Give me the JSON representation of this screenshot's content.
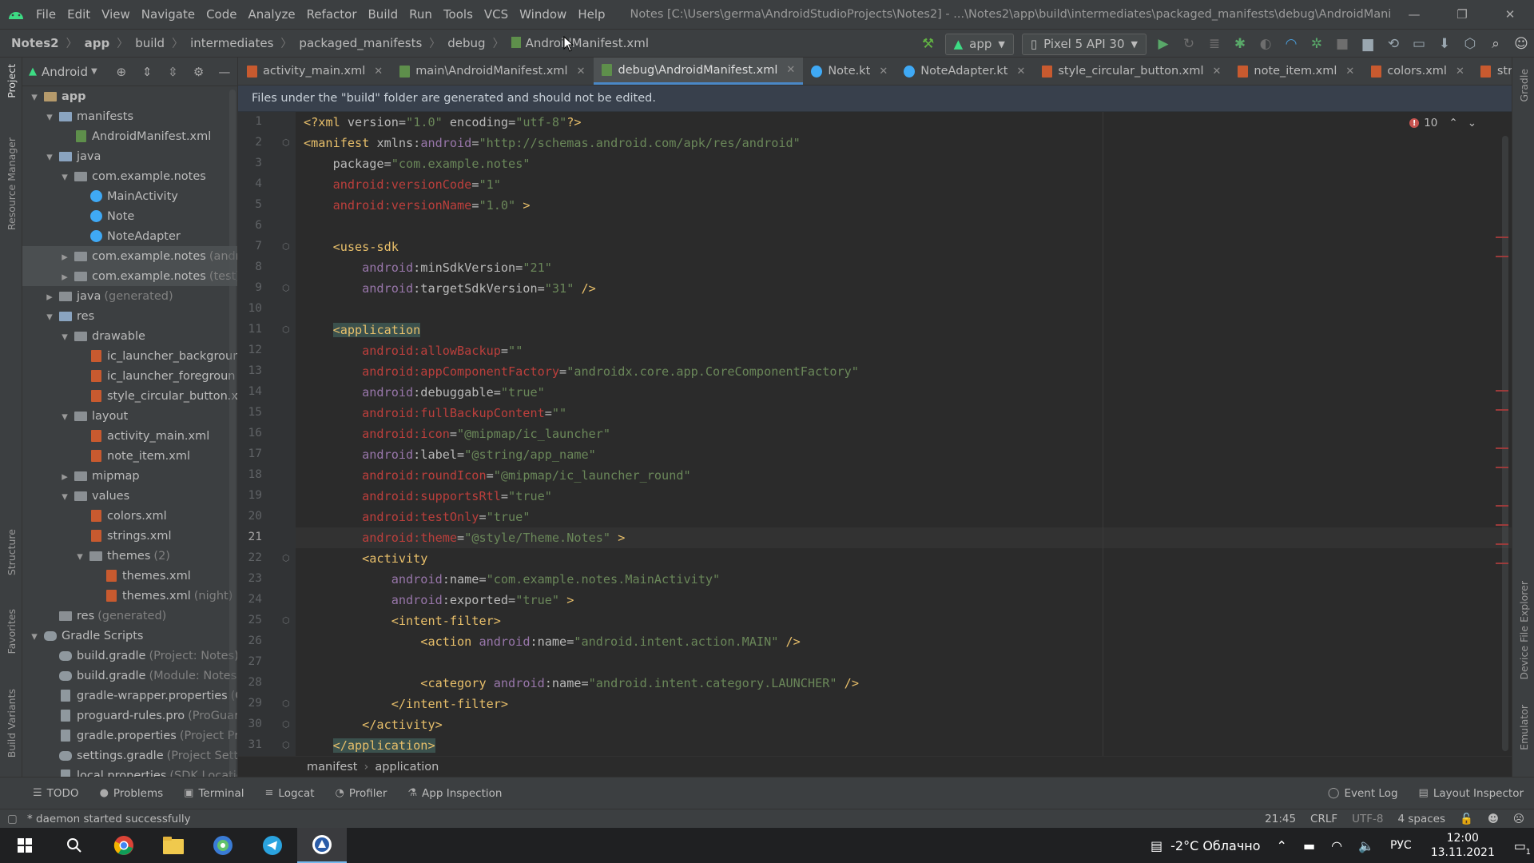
{
  "window": {
    "title": "Notes [C:\\Users\\germa\\AndroidStudioProjects\\Notes2] - ...\\Notes2\\app\\build\\intermediates\\packaged_manifests\\debug\\AndroidManifest.xml",
    "minimize": "—",
    "restore": "❐",
    "close": "✕"
  },
  "menu": [
    "File",
    "Edit",
    "View",
    "Navigate",
    "Code",
    "Analyze",
    "Refactor",
    "Build",
    "Run",
    "Tools",
    "VCS",
    "Window",
    "Help"
  ],
  "breadcrumb": [
    "Notes2",
    "app",
    "build",
    "intermediates",
    "packaged_manifests",
    "debug",
    "AndroidManifest.xml"
  ],
  "toolbar": {
    "run_config": "app",
    "device": "Pixel 5 API 30"
  },
  "left_strip": [
    "Project",
    "Resource Manager",
    "Structure",
    "Favorites",
    "Build Variants"
  ],
  "right_strip": [
    "Gradle",
    "Device File Explorer",
    "Emulator"
  ],
  "project_panel": {
    "view_name": "Android",
    "tree": [
      {
        "label": "app",
        "ext": "",
        "depth": 0,
        "arrow": "v",
        "icon": "folder-tan",
        "bold": true
      },
      {
        "label": "manifests",
        "ext": "",
        "depth": 1,
        "arrow": "v",
        "icon": "folder"
      },
      {
        "label": "AndroidManifest.xml",
        "ext": "",
        "depth": 2,
        "arrow": "",
        "icon": "xml-green"
      },
      {
        "label": "java",
        "ext": "",
        "depth": 1,
        "arrow": "v",
        "icon": "folder"
      },
      {
        "label": "com.example.notes",
        "ext": "",
        "depth": 2,
        "arrow": "v",
        "icon": "folder-grey"
      },
      {
        "label": "MainActivity",
        "ext": "",
        "depth": 3,
        "arrow": "",
        "icon": "kt"
      },
      {
        "label": "Note",
        "ext": "",
        "depth": 3,
        "arrow": "",
        "icon": "kt"
      },
      {
        "label": "NoteAdapter",
        "ext": "",
        "depth": 3,
        "arrow": "",
        "icon": "kt"
      },
      {
        "label": "com.example.notes",
        "ext": "(andro",
        "depth": 2,
        "arrow": ">",
        "icon": "folder-grey",
        "sel": true
      },
      {
        "label": "com.example.notes",
        "ext": "(test)",
        "depth": 2,
        "arrow": ">",
        "icon": "folder-grey",
        "sel": true
      },
      {
        "label": "java",
        "ext": "(generated)",
        "depth": 1,
        "arrow": ">",
        "icon": "folder-grey"
      },
      {
        "label": "res",
        "ext": "",
        "depth": 1,
        "arrow": "v",
        "icon": "folder"
      },
      {
        "label": "drawable",
        "ext": "",
        "depth": 2,
        "arrow": "v",
        "icon": "folder-grey"
      },
      {
        "label": "ic_launcher_backgroun",
        "ext": "",
        "depth": 3,
        "arrow": "",
        "icon": "xml"
      },
      {
        "label": "ic_launcher_foregroun",
        "ext": "",
        "depth": 3,
        "arrow": "",
        "icon": "xml"
      },
      {
        "label": "style_circular_button.xm",
        "ext": "",
        "depth": 3,
        "arrow": "",
        "icon": "xml"
      },
      {
        "label": "layout",
        "ext": "",
        "depth": 2,
        "arrow": "v",
        "icon": "folder-grey"
      },
      {
        "label": "activity_main.xml",
        "ext": "",
        "depth": 3,
        "arrow": "",
        "icon": "xml"
      },
      {
        "label": "note_item.xml",
        "ext": "",
        "depth": 3,
        "arrow": "",
        "icon": "xml"
      },
      {
        "label": "mipmap",
        "ext": "",
        "depth": 2,
        "arrow": ">",
        "icon": "folder-grey"
      },
      {
        "label": "values",
        "ext": "",
        "depth": 2,
        "arrow": "v",
        "icon": "folder-grey"
      },
      {
        "label": "colors.xml",
        "ext": "",
        "depth": 3,
        "arrow": "",
        "icon": "xml"
      },
      {
        "label": "strings.xml",
        "ext": "",
        "depth": 3,
        "arrow": "",
        "icon": "xml"
      },
      {
        "label": "themes",
        "ext": "(2)",
        "depth": 3,
        "arrow": "v",
        "icon": "folder-grey"
      },
      {
        "label": "themes.xml",
        "ext": "",
        "depth": 4,
        "arrow": "",
        "icon": "xml"
      },
      {
        "label": "themes.xml",
        "ext": "(night)",
        "depth": 4,
        "arrow": "",
        "icon": "xml"
      },
      {
        "label": "res",
        "ext": "(generated)",
        "depth": 1,
        "arrow": "",
        "icon": "folder-grey"
      },
      {
        "label": "Gradle Scripts",
        "ext": "",
        "depth": 0,
        "arrow": "v",
        "icon": "gradle"
      },
      {
        "label": "build.gradle",
        "ext": "(Project: Notes)",
        "depth": 1,
        "arrow": "",
        "icon": "gradle"
      },
      {
        "label": "build.gradle",
        "ext": "(Module: Notes.a",
        "depth": 1,
        "arrow": "",
        "icon": "gradle"
      },
      {
        "label": "gradle-wrapper.properties",
        "ext": "(G",
        "depth": 1,
        "arrow": "",
        "icon": "prop"
      },
      {
        "label": "proguard-rules.pro",
        "ext": "(ProGuard",
        "depth": 1,
        "arrow": "",
        "icon": "prop"
      },
      {
        "label": "gradle.properties",
        "ext": "(Project Pro",
        "depth": 1,
        "arrow": "",
        "icon": "prop"
      },
      {
        "label": "settings.gradle",
        "ext": "(Project Settin",
        "depth": 1,
        "arrow": "",
        "icon": "gradle"
      },
      {
        "label": "local.properties",
        "ext": "(SDK Location",
        "depth": 1,
        "arrow": "",
        "icon": "prop"
      }
    ]
  },
  "tabs": [
    {
      "label": "activity_main.xml",
      "icon": "xml",
      "active": false
    },
    {
      "label": "main\\AndroidManifest.xml",
      "icon": "xml-green",
      "active": false
    },
    {
      "label": "debug\\AndroidManifest.xml",
      "icon": "xml-green",
      "active": true
    },
    {
      "label": "Note.kt",
      "icon": "kt",
      "active": false
    },
    {
      "label": "NoteAdapter.kt",
      "icon": "kt",
      "active": false
    },
    {
      "label": "style_circular_button.xml",
      "icon": "xml",
      "active": false
    },
    {
      "label": "note_item.xml",
      "icon": "xml",
      "active": false
    },
    {
      "label": "colors.xml",
      "icon": "xml",
      "active": false
    },
    {
      "label": "strings.xml",
      "icon": "xml",
      "active": false
    }
  ],
  "notice": "Files under the \"build\" folder are generated and should not be edited.",
  "editor": {
    "error_count": "10",
    "current_line": 21,
    "lines": [
      [
        [
          "t-pun",
          "<?"
        ],
        [
          "t-tag",
          "xml "
        ],
        [
          "t-attr",
          "version"
        ],
        [
          "t-attr",
          "="
        ],
        [
          "t-val",
          "\"1.0\""
        ],
        [
          "t-attr",
          " encoding"
        ],
        [
          "t-attr",
          "="
        ],
        [
          "t-val",
          "\"utf-8\""
        ],
        [
          "t-pun",
          "?>"
        ]
      ],
      [
        [
          "t-tag",
          "<manifest "
        ],
        [
          "t-attr",
          "xmlns:"
        ],
        [
          "t-ns",
          "android"
        ],
        [
          "t-attr",
          "="
        ],
        [
          "t-val",
          "\"http://schemas.android.com/apk/res/android\""
        ]
      ],
      [
        [
          "t-attr",
          "    package"
        ],
        [
          "t-attr",
          "="
        ],
        [
          "t-val",
          "\"com.example.notes\""
        ]
      ],
      [
        [
          "t-err",
          "    android:versionCode"
        ],
        [
          "t-attr",
          "="
        ],
        [
          "t-val",
          "\"1\""
        ]
      ],
      [
        [
          "t-err",
          "    android:versionName"
        ],
        [
          "t-attr",
          "="
        ],
        [
          "t-val",
          "\"1.0\""
        ],
        [
          "t-tag",
          " >"
        ]
      ],
      [],
      [
        [
          "t-tag",
          "    <uses-sdk"
        ]
      ],
      [
        [
          "t-ns",
          "        android"
        ],
        [
          "t-attr",
          ":minSdkVersion"
        ],
        [
          "t-attr",
          "="
        ],
        [
          "t-val",
          "\"21\""
        ]
      ],
      [
        [
          "t-ns",
          "        android"
        ],
        [
          "t-attr",
          ":targetSdkVersion"
        ],
        [
          "t-attr",
          "="
        ],
        [
          "t-val",
          "\"31\""
        ],
        [
          "t-tag",
          " />"
        ]
      ],
      [],
      [
        [
          "t-attr",
          "    "
        ],
        [
          "t-tag hl-app",
          "<application"
        ]
      ],
      [
        [
          "t-err",
          "        android:allowBackup"
        ],
        [
          "t-attr",
          "="
        ],
        [
          "t-val",
          "\"\""
        ]
      ],
      [
        [
          "t-err",
          "        android:appComponentFactory"
        ],
        [
          "t-attr",
          "="
        ],
        [
          "t-val",
          "\"androidx.core.app.CoreComponentFactory\""
        ]
      ],
      [
        [
          "t-ns",
          "        android"
        ],
        [
          "t-attr",
          ":debuggable"
        ],
        [
          "t-attr",
          "="
        ],
        [
          "t-val",
          "\"true\""
        ]
      ],
      [
        [
          "t-err",
          "        android:fullBackupContent"
        ],
        [
          "t-attr",
          "="
        ],
        [
          "t-val",
          "\"\""
        ]
      ],
      [
        [
          "t-err",
          "        android:icon"
        ],
        [
          "t-attr",
          "="
        ],
        [
          "t-val",
          "\"@mipmap/ic_launcher\""
        ]
      ],
      [
        [
          "t-ns",
          "        android"
        ],
        [
          "t-attr",
          ":label"
        ],
        [
          "t-attr",
          "="
        ],
        [
          "t-val",
          "\"@string/app_name\""
        ]
      ],
      [
        [
          "t-err",
          "        android:roundIcon"
        ],
        [
          "t-attr",
          "="
        ],
        [
          "t-val",
          "\"@mipmap/ic_launcher_round\""
        ]
      ],
      [
        [
          "t-err",
          "        android:supportsRtl"
        ],
        [
          "t-attr",
          "="
        ],
        [
          "t-val",
          "\"true\""
        ]
      ],
      [
        [
          "t-err",
          "        android:testOnly"
        ],
        [
          "t-attr",
          "="
        ],
        [
          "t-val",
          "\"true\""
        ]
      ],
      [
        [
          "t-err",
          "        android:theme"
        ],
        [
          "t-attr",
          "="
        ],
        [
          "t-val",
          "\"@style/Theme.Notes\""
        ],
        [
          "t-tag",
          " >"
        ]
      ],
      [
        [
          "t-tag",
          "        <activity"
        ]
      ],
      [
        [
          "t-ns",
          "            android"
        ],
        [
          "t-attr",
          ":name"
        ],
        [
          "t-attr",
          "="
        ],
        [
          "t-val",
          "\"com.example.notes.MainActivity\""
        ]
      ],
      [
        [
          "t-ns",
          "            android"
        ],
        [
          "t-attr",
          ":exported"
        ],
        [
          "t-attr",
          "="
        ],
        [
          "t-val",
          "\"true\""
        ],
        [
          "t-tag",
          " >"
        ]
      ],
      [
        [
          "t-tag",
          "            <intent-filter>"
        ]
      ],
      [
        [
          "t-tag",
          "                <action "
        ],
        [
          "t-ns",
          "android"
        ],
        [
          "t-attr",
          ":name"
        ],
        [
          "t-attr",
          "="
        ],
        [
          "t-val",
          "\"android.intent.action.MAIN\""
        ],
        [
          "t-tag",
          " />"
        ]
      ],
      [],
      [
        [
          "t-tag",
          "                <category "
        ],
        [
          "t-ns",
          "android"
        ],
        [
          "t-attr",
          ":name"
        ],
        [
          "t-attr",
          "="
        ],
        [
          "t-val",
          "\"android.intent.category.LAUNCHER\""
        ],
        [
          "t-tag",
          " />"
        ]
      ],
      [
        [
          "t-tag",
          "            </intent-filter>"
        ]
      ],
      [
        [
          "t-tag",
          "        </activity>"
        ]
      ],
      [
        [
          "t-attr",
          "    "
        ],
        [
          "t-tag hl-app",
          "</application>"
        ]
      ]
    ],
    "fold_lines": [
      2,
      7,
      9,
      11,
      22,
      25,
      29,
      30,
      31
    ]
  },
  "editor_breadcrumb": [
    "manifest",
    "application"
  ],
  "bottom_tools_left": [
    {
      "label": "TODO",
      "icon": "☰"
    },
    {
      "label": "Problems",
      "icon": "●"
    },
    {
      "label": "Terminal",
      "icon": "▣"
    },
    {
      "label": "Logcat",
      "icon": "≡"
    },
    {
      "label": "Profiler",
      "icon": "◔"
    },
    {
      "label": "App Inspection",
      "icon": "⚗"
    }
  ],
  "bottom_tools_right": [
    {
      "label": "Event Log",
      "icon": "◯"
    },
    {
      "label": "Layout Inspector",
      "icon": "▤"
    }
  ],
  "status": {
    "message": "* daemon started successfully",
    "position": "21:45",
    "line_sep": "CRLF",
    "encoding": "UTF-8",
    "indent": "4 spaces"
  },
  "taskbar": {
    "weather": "-2°C  Облачно",
    "lang": "РУС",
    "time": "12:00",
    "date": "13.11.2021",
    "notif_count": "1"
  }
}
